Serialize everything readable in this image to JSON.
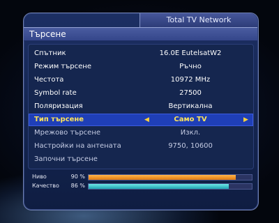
{
  "header": {
    "network_tab": "Total TV Network",
    "title": "Търсене"
  },
  "settings": {
    "rows": [
      {
        "label": "Спътник",
        "value": "16.0E EutelsatW2"
      },
      {
        "label": "Режим търсене",
        "value": "Ръчно"
      },
      {
        "label": "Честота",
        "value": "10972 MHz"
      },
      {
        "label": "Symbol rate",
        "value": "27500"
      },
      {
        "label": "Поляризация",
        "value": "Вертикална"
      },
      {
        "label": "Тип търсене",
        "value": "Само TV"
      },
      {
        "label": "Мрежово търсене",
        "value": "Изкл."
      },
      {
        "label": "Настройки на антената",
        "value": "9750, 10600"
      },
      {
        "label": "Започни търсене",
        "value": ""
      }
    ],
    "selected_index": 5
  },
  "signal": {
    "level_label": "Ниво",
    "level_pct": "90 %",
    "level_value": 90,
    "quality_label": "Качество",
    "quality_pct": "86 %",
    "quality_value": 86
  },
  "icons": {
    "left_arrow": "left-triangle-arrow",
    "right_arrow": "right-triangle-arrow"
  },
  "colors": {
    "selection": "#1f3fb7",
    "selected_text": "#ffe45a",
    "level_bar": "#f0951e",
    "quality_bar": "#2fc0c8"
  }
}
